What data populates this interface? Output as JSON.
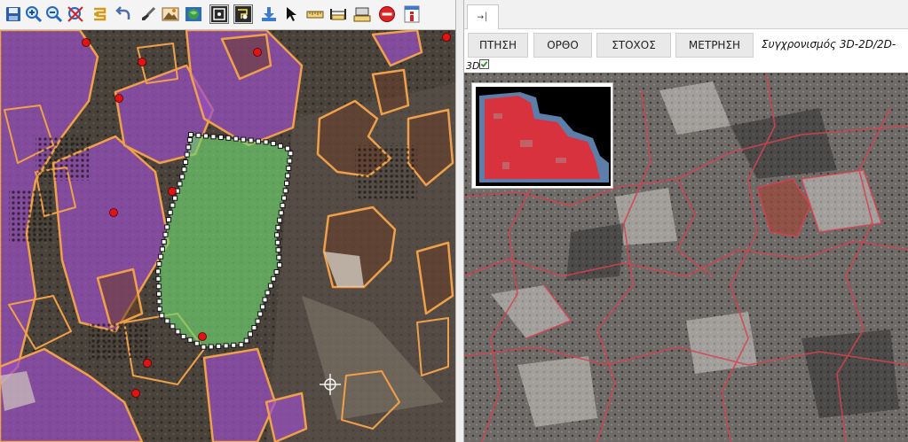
{
  "left_toolbar": {
    "tools": [
      {
        "icon": "save-icon"
      },
      {
        "icon": "zoom-in-icon"
      },
      {
        "icon": "zoom-out-icon"
      },
      {
        "icon": "zoom-extent-icon"
      },
      {
        "icon": "rotate-icon"
      },
      {
        "icon": "undo-icon"
      },
      {
        "icon": "brush-icon"
      },
      {
        "icon": "image-layer-icon"
      },
      {
        "icon": "globe-icon"
      },
      {
        "icon": "select-point-icon",
        "active": true
      },
      {
        "icon": "select-area-icon",
        "active": true
      },
      {
        "icon": "download-icon"
      },
      {
        "icon": "pointer-icon"
      },
      {
        "icon": "ruler-icon"
      },
      {
        "icon": "measure-width-icon"
      },
      {
        "icon": "measure-area-icon"
      },
      {
        "icon": "stop-icon"
      },
      {
        "icon": "info-icon"
      }
    ]
  },
  "right_panel": {
    "tab": {
      "icon": "pin-tab-icon"
    },
    "buttons": {
      "flight": "ΠΤΗΣΗ",
      "ortho": "ΟΡΘΟ",
      "target": "ΣΤΟΧΟΣ",
      "measure": "ΜΕΤΡΗΣΗ"
    },
    "sync": {
      "label": "Συγχρονισμός 3D-2D/2D-",
      "label_cont": "3D",
      "checked": true
    }
  },
  "colors": {
    "parcel_outline": "#f0a048",
    "parcel_fill": "#9a4fc0",
    "selected_fill": "#6fd36f",
    "point_marker": "#e01414",
    "right_boundary": "#d9414f"
  }
}
